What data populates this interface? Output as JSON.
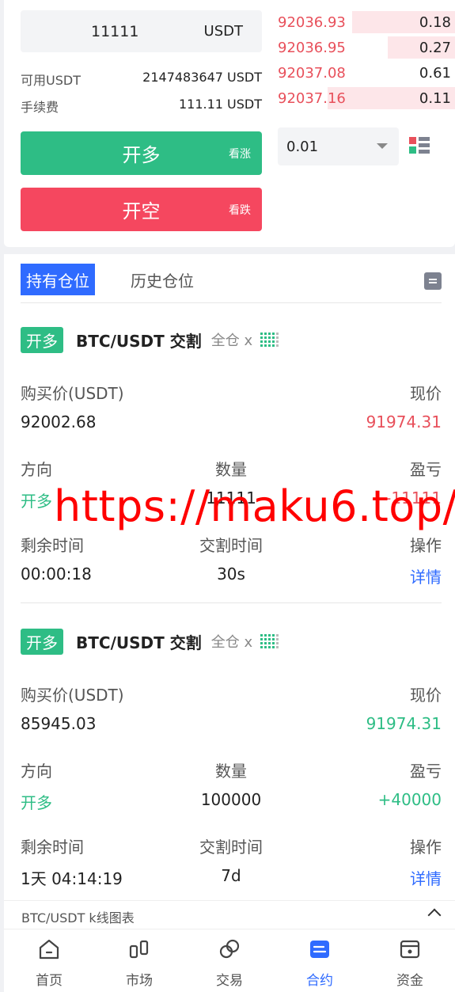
{
  "order_form": {
    "amount_value": "11111",
    "amount_unit": "USDT",
    "available_label": "可用USDT",
    "available_value": "2147483647 USDT",
    "fee_label": "手续费",
    "fee_value": "111.11 USDT",
    "long_button": "开多",
    "long_sub": "看涨",
    "short_button": "开空",
    "short_sub": "看跌"
  },
  "order_book": {
    "asks": [
      {
        "price": "92036.93",
        "qty": "0.18",
        "depth": 0.58
      },
      {
        "price": "92036.95",
        "qty": "0.27",
        "depth": 0.38
      },
      {
        "price": "92037.08",
        "qty": "0.61",
        "depth": 0.0
      },
      {
        "price": "92037.16",
        "qty": "0.11",
        "depth": 0.72
      }
    ],
    "depth_select": "0.01"
  },
  "positions": {
    "tab_active": "持有仓位",
    "tab_history": "历史仓位",
    "buy_price_label": "购买价(USDT)",
    "current_price_label": "现价",
    "direction_label": "方向",
    "quantity_label": "数量",
    "pnl_label": "盈亏",
    "remaining_label": "剩余时间",
    "delivery_label": "交割时间",
    "action_label": "操作",
    "items": [
      {
        "badge": "开多",
        "pair": "BTC/USDT 交割",
        "mode": "全仓 x",
        "buy_price": "92002.68",
        "current_price": "91974.31",
        "direction": "开多",
        "quantity": "11111",
        "pnl": "-11111",
        "remaining": "00:00:18",
        "delivery": "30s",
        "action": "详情"
      },
      {
        "badge": "开多",
        "pair": "BTC/USDT 交割",
        "mode": "全仓 x",
        "buy_price": "85945.03",
        "current_price": "91974.31",
        "direction": "开多",
        "quantity": "100000",
        "pnl": "+40000",
        "remaining": "1天 04:14:19",
        "delivery": "7d",
        "action": "详情"
      }
    ]
  },
  "watermark": "https://maku6.top/",
  "kline": {
    "label": "BTC/USDT k线图表"
  },
  "tabbar": [
    {
      "label": "首页",
      "icon": "home-icon"
    },
    {
      "label": "市场",
      "icon": "market-icon"
    },
    {
      "label": "交易",
      "icon": "trade-icon"
    },
    {
      "label": "合约",
      "icon": "contract-icon",
      "active": true
    },
    {
      "label": "资金",
      "icon": "wallet-icon"
    }
  ],
  "colors": {
    "up": "#2ebd85",
    "down": "#e8505b",
    "accent": "#2f6bff"
  }
}
